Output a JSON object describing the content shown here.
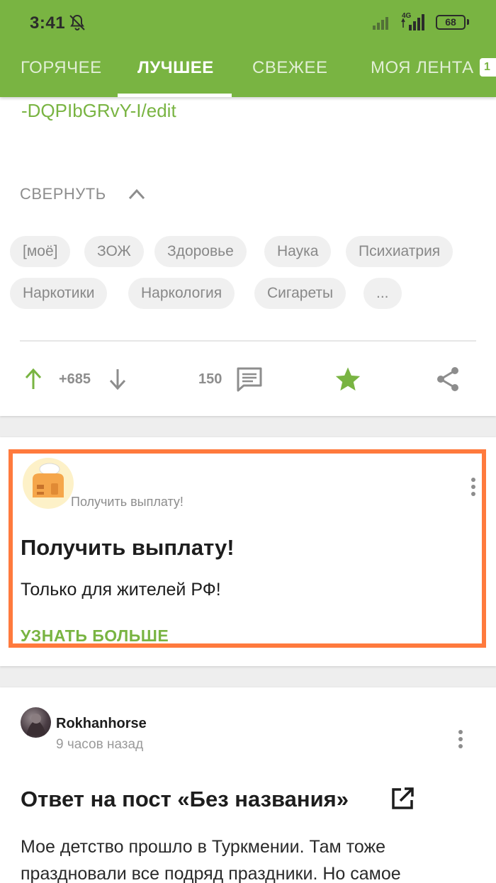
{
  "status_bar": {
    "time": "3:41",
    "network": "4G",
    "battery": "68"
  },
  "tabs": [
    {
      "label": "ГОРЯЧЕЕ",
      "active": false
    },
    {
      "label": "ЛУЧШЕЕ",
      "active": true
    },
    {
      "label": "СВЕЖЕЕ",
      "active": false
    },
    {
      "label": "МОЯ ЛЕНТА",
      "active": false
    }
  ],
  "tab_badge": "1",
  "post1": {
    "link_continuation": "-DQPIbGRvY-I/edit",
    "collapse_label": "СВЕРНУТЬ",
    "tags": [
      "[моё]",
      "ЗОЖ",
      "Здоровье",
      "Наука",
      "Психиатрия",
      "Наркотики",
      "Наркология",
      "Сигареты",
      "..."
    ],
    "rating": "+685",
    "comments": "150",
    "saved": true
  },
  "ad": {
    "source": "Получить выплату!",
    "title": "Получить выплату!",
    "text": "Только для жителей РФ!",
    "cta": "УЗНАТЬ БОЛЬШЕ"
  },
  "post2": {
    "author": "Rokhanhorse",
    "time": "9 часов назад",
    "title": "Ответ на пост «Без названия»",
    "body": "Мое детство прошло в Туркмении. Там тоже праздновали все подряд праздники. Но самое"
  },
  "colors": {
    "brand": "#79b442",
    "ad_border": "#ff7a3d",
    "text": "#1d1d1d",
    "muted": "#8d8d8d"
  }
}
